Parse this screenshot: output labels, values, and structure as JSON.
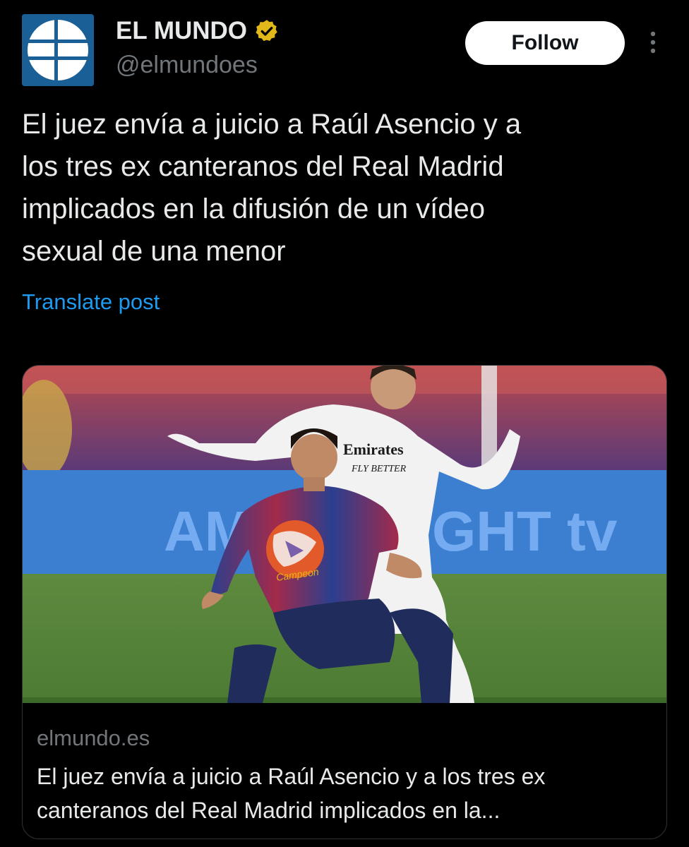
{
  "post": {
    "author": {
      "name": "EL MUNDO",
      "handle": "@elmundoes",
      "verified": true,
      "verified_color": "#e2b719"
    },
    "follow_label": "Follow",
    "text": "El juez envía a juicio a Raúl Asencio y a\nlos tres ex canteranos del Real Madrid\nimplicados en la difusión de un vídeo\nsexual de una menor",
    "translate_label": "Translate post",
    "card": {
      "image_icon": "football-photo",
      "image_texts": {
        "sponsor_line1": "Emirates",
        "sponsor_line2": "FLY BETTER"
      },
      "domain": "elmundo.es",
      "title": "El juez envía a juicio a Raúl Asencio y a los tres ex canteranos del Real Madrid implicados en la..."
    }
  },
  "colors": {
    "background": "#000000",
    "text": "#e7e9ea",
    "muted": "#71767b",
    "link": "#1d9bf0",
    "brand_blue": "#1b5f97"
  },
  "icons": {
    "avatar": "el-mundo-globe-logo",
    "verified": "verified-badge-icon",
    "more": "more-vertical-icon"
  }
}
